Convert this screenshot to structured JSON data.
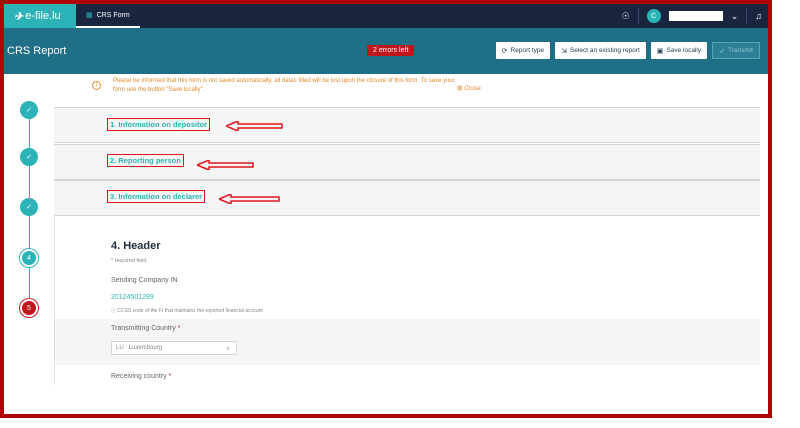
{
  "topbar": {
    "logo": "e-file.lu",
    "tab_label": "CRS Form",
    "user_initial": "C",
    "icons": [
      "help-icon",
      "chevron-down-icon",
      "bell-icon"
    ]
  },
  "header": {
    "title": "CRS Report",
    "errors_badge": "2 errors left",
    "buttons": {
      "report_type": "Report type",
      "select_existing": "Select an existing report",
      "save_locally": "Save locally",
      "transmit": "Transmit"
    }
  },
  "notice": {
    "text": "Please be informed that this form is not saved automatically, all datas filled will be lost upon the closure of this form. To save your form use the button \"Save locally\".",
    "close_label": "Close"
  },
  "steps": [
    {
      "label": "✓",
      "status": "done"
    },
    {
      "label": "✓",
      "status": "done"
    },
    {
      "label": "✓",
      "status": "done"
    },
    {
      "label": "4",
      "status": "current"
    },
    {
      "label": "5",
      "status": "error"
    }
  ],
  "sections": [
    {
      "title": "1. Information on depositor"
    },
    {
      "title": "2. Reporting person"
    },
    {
      "title": "3. Information on declarer"
    }
  ],
  "form": {
    "heading": "4. Header",
    "required_note": "* required field",
    "sending_company_label": "Sending Company IN",
    "sending_company_value": "20124501289",
    "sending_company_hint": "CCSS code of the FI that maintains the reported financial account",
    "transmitting_country_label": "Transmitting Country",
    "transmitting_country_value": "LU : Luxembourg",
    "receiving_country_label": "Receiving country",
    "required_mark": "*"
  },
  "colors": {
    "accent": "#2bb3b7",
    "topbar": "#1a2540",
    "subheader": "#1f6f86",
    "error": "#c0171d",
    "warning": "#e58a2b",
    "annotation": "#e2141a"
  }
}
